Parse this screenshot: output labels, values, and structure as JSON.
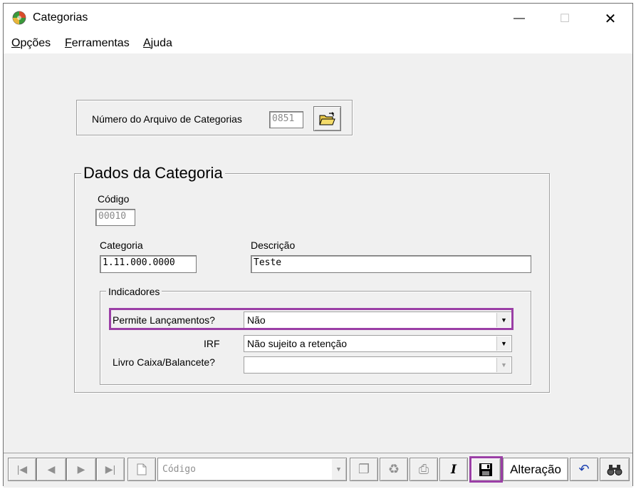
{
  "window": {
    "title": "Categorias",
    "controls": {
      "minimize": "—",
      "maximize": "☐",
      "close": "✕"
    }
  },
  "menu": {
    "items": [
      {
        "first": "O",
        "rest": "pções"
      },
      {
        "first": "F",
        "rest": "erramentas"
      },
      {
        "first": "A",
        "rest": "juda"
      }
    ]
  },
  "file_box": {
    "label": "Número do Arquivo de Categorias",
    "value": "0851"
  },
  "category": {
    "group_title": "Dados da Categoria",
    "codigo_label": "Código",
    "codigo_value": "00010",
    "categoria_label": "Categoria",
    "categoria_value": "1.11.000.0000",
    "descricao_label": "Descrição",
    "descricao_value": "Teste"
  },
  "indicators": {
    "group_title": "Indicadores",
    "permite_label": "Permite Lançamentos?",
    "permite_value": "Não",
    "irf_label": "IRF",
    "irf_value": "Não sujeito a retenção",
    "livro_label": "Livro Caixa/Balancete?",
    "livro_value": ""
  },
  "toolbar": {
    "search_field_placeholder": "Código",
    "mode_label": "Alteração",
    "italic_label": "I"
  },
  "colors": {
    "highlight": "#9b3fa6"
  }
}
